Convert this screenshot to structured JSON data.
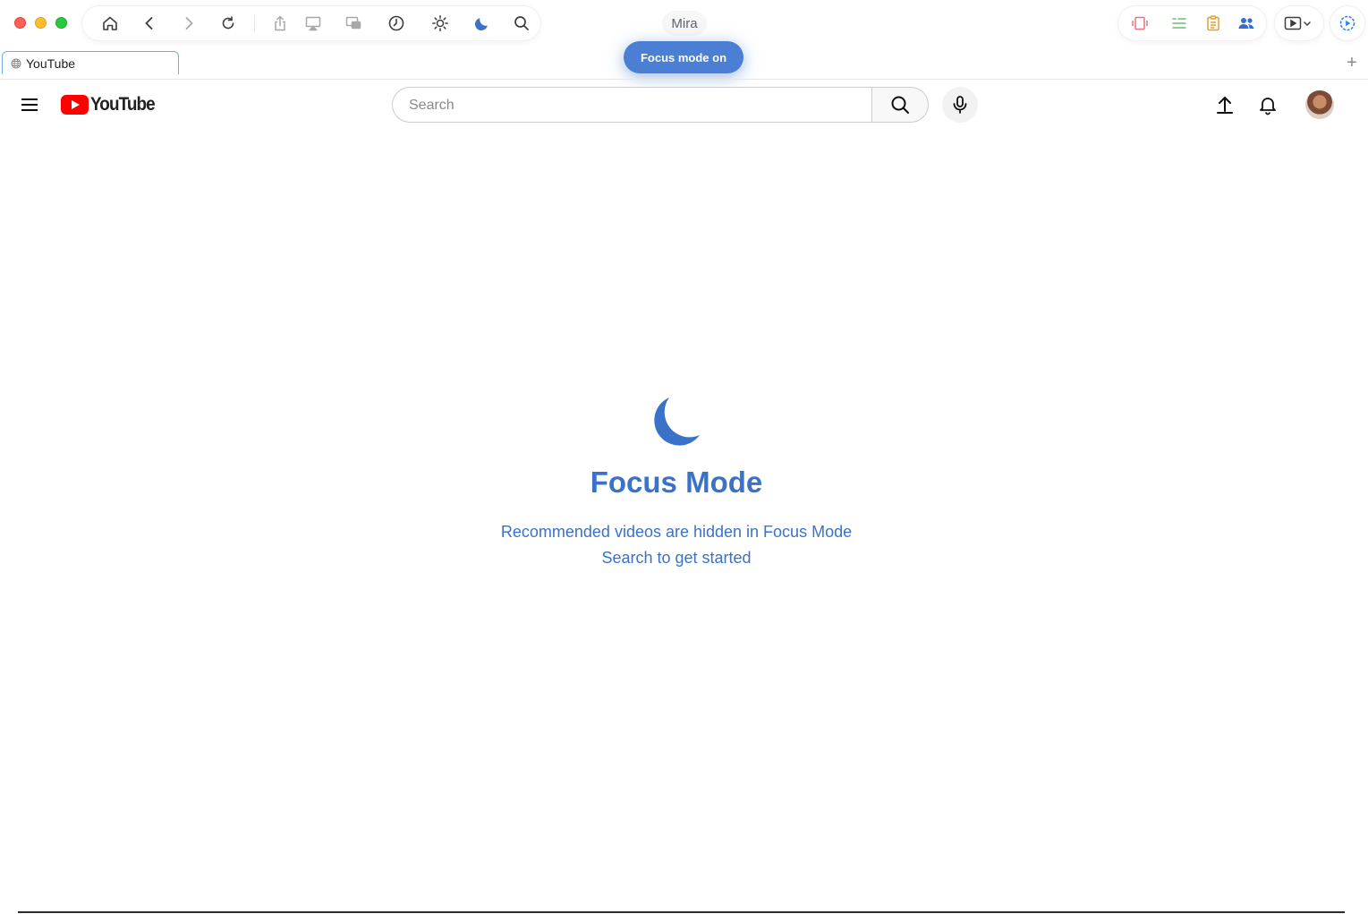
{
  "browser": {
    "profile_name": "Mira",
    "toast": "Focus mode on",
    "toolbar_icons": [
      "home-icon",
      "back-icon",
      "forward-icon",
      "reload-icon",
      "share-icon",
      "airplay-icon",
      "picture-in-picture-icon",
      "history-icon",
      "brightness-icon",
      "moon-icon",
      "search-icon"
    ],
    "right_icons": [
      "video-frame-icon",
      "notes-list-icon",
      "clipboard-icon",
      "people-icon",
      "media-player-icon",
      "settings-gear-icon"
    ],
    "tab": {
      "title": "YouTube"
    },
    "new_tab_glyph": "+"
  },
  "youtube": {
    "logo_text": "YouTube",
    "search": {
      "placeholder": "Search",
      "value": ""
    }
  },
  "focus": {
    "title": "Focus Mode",
    "line1": "Recommended videos are hidden in Focus Mode",
    "line2": "Search to get started"
  },
  "colors": {
    "accent": "#3a72c9",
    "toast": "#4a7fd4",
    "youtube_red": "#ff0000"
  }
}
